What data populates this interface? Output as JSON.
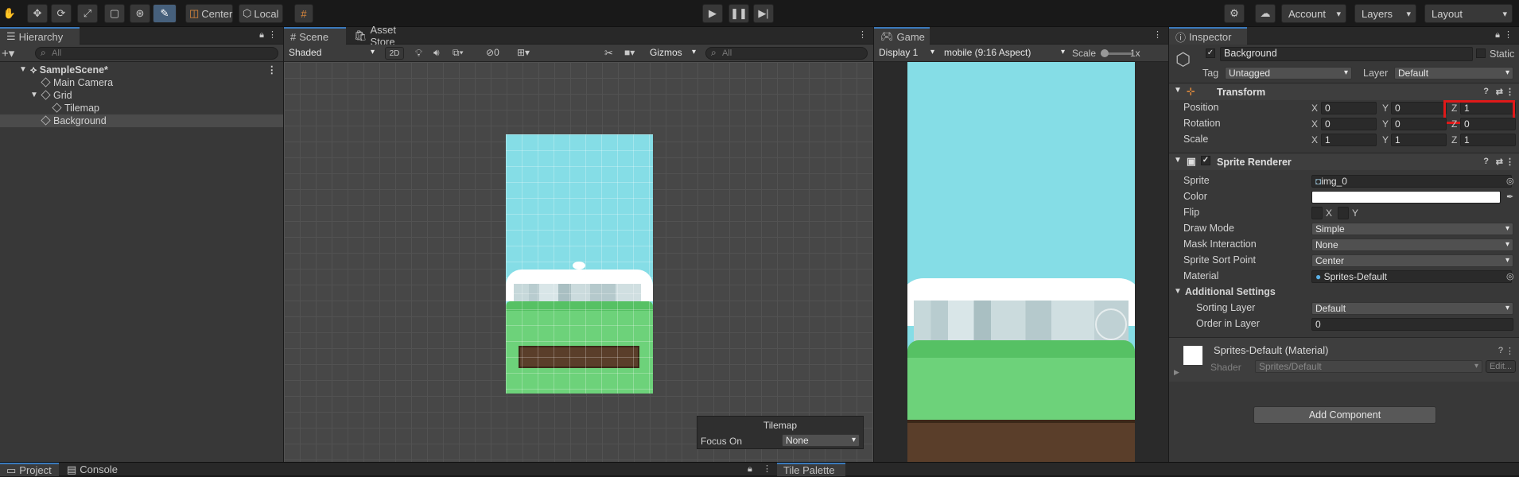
{
  "toolbar": {
    "tools": [
      "hand-tool",
      "move-tool",
      "rotate-tool",
      "scale-tool",
      "rect-tool",
      "transform-tool",
      "custom-tool"
    ],
    "pivot_label": "Center",
    "space_label": "Local",
    "account_label": "Account",
    "layers_label": "Layers",
    "layout_label": "Layout"
  },
  "hierarchy": {
    "tab": "Hierarchy",
    "search_placeholder": "All",
    "scene": "SampleScene*",
    "items": [
      "Main Camera",
      "Grid",
      "Tilemap",
      "Background"
    ]
  },
  "scene_view": {
    "tabs": [
      "Scene",
      "Asset Store"
    ],
    "shading": "Shaded",
    "mode_2d": "2D",
    "hidden_count": "0",
    "gizmos": "Gizmos",
    "search_placeholder": "All",
    "overlay_title": "Tilemap",
    "focus_label": "Focus On",
    "focus_value": "None"
  },
  "game_view": {
    "tab": "Game",
    "display": "Display 1",
    "aspect": "mobile (9:16 Aspect)",
    "scale_label": "Scale",
    "scale_value": "1x"
  },
  "inspector": {
    "tab": "Inspector",
    "object_name": "Background",
    "static_label": "Static",
    "tag_label": "Tag",
    "tag_value": "Untagged",
    "layer_label": "Layer",
    "layer_value": "Default",
    "transform": {
      "title": "Transform",
      "position": {
        "label": "Position",
        "x": "0",
        "y": "0",
        "z": "1"
      },
      "rotation": {
        "label": "Rotation",
        "x": "0",
        "y": "0",
        "z": "0"
      },
      "scale": {
        "label": "Scale",
        "x": "1",
        "y": "1",
        "z": "1"
      }
    },
    "axis": {
      "x": "X",
      "y": "Y",
      "z": "Z"
    },
    "sprite_renderer": {
      "title": "Sprite Renderer",
      "sprite_label": "Sprite",
      "sprite_value": "img_0",
      "color_label": "Color",
      "flip_label": "Flip",
      "flip_x": "X",
      "flip_y": "Y",
      "draw_mode_label": "Draw Mode",
      "draw_mode_value": "Simple",
      "mask_label": "Mask Interaction",
      "mask_value": "None",
      "sort_point_label": "Sprite Sort Point",
      "sort_point_value": "Center",
      "material_label": "Material",
      "material_value": "Sprites-Default",
      "additional_label": "Additional Settings",
      "sorting_layer_label": "Sorting Layer",
      "sorting_layer_value": "Default",
      "order_label": "Order in Layer",
      "order_value": "0"
    },
    "material": {
      "name": "Sprites-Default (Material)",
      "shader_label": "Shader",
      "shader_value": "Sprites/Default",
      "edit_label": "Edit..."
    },
    "add_component": "Add Component"
  },
  "bottom": {
    "tabs": [
      "Project",
      "Console"
    ],
    "tile_palette": "Tile Palette"
  },
  "colors": {
    "accent": "#3a79bb",
    "highlight": "#e01919",
    "sky": "#85dde6",
    "grass": "#6dd27a"
  }
}
